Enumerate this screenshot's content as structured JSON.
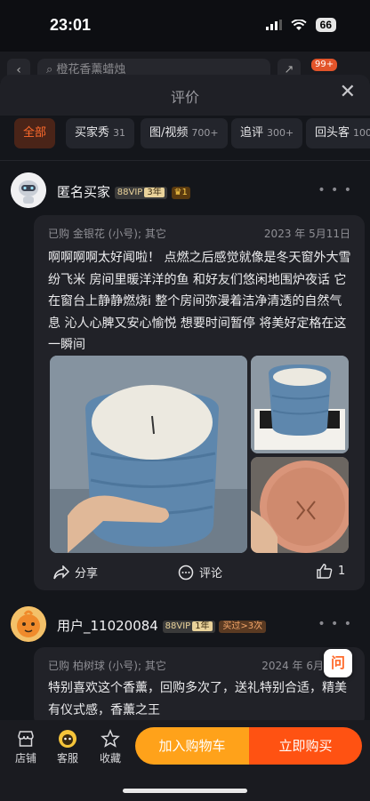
{
  "status": {
    "time": "23:01",
    "battery": "66"
  },
  "behind": {
    "search_text": "橙花香薰蜡烛",
    "cart_badge": "99+"
  },
  "sheet": {
    "title": "评价"
  },
  "filters": [
    {
      "label": "全部",
      "count": "",
      "active": true
    },
    {
      "label": "买家秀",
      "count": "31"
    },
    {
      "label": "图/视频",
      "count": "700+"
    },
    {
      "label": "追评",
      "count": "300+"
    },
    {
      "label": "回头客",
      "count": "100"
    }
  ],
  "review1": {
    "user": "匿名买家",
    "vip": "88VIP",
    "vip_years": "3年",
    "crown_level": "1",
    "purchase": "已购 金银花 (小号); 其它",
    "date": "2023 年 5月11日",
    "text": "啊啊啊啊太好闻啦！ 点燃之后感觉就像是冬天窗外大雪纷飞米 房间里暖洋洋的鱼 和好友们悠闲地围炉夜话 它在窗台上静静燃烧i 整个房间弥漫着洁净清透的自然气息 沁人心脾又安心愉悦 想要时间暂停 将美好定格在这一瞬间",
    "share": "分享",
    "comment": "评论",
    "likes": "1"
  },
  "review2": {
    "user": "用户_11020084",
    "vip": "88VIP",
    "vip_years": "1年",
    "repurchase_tag": "买过>3次",
    "purchase": "已购 柏树球 (小号); 其它",
    "date": "2024 年 6月",
    "text": "特别喜欢这个香薰，回购多次了，送礼特别合适，精美有仪式感，香薰之王",
    "ask_label": "问"
  },
  "bottom": {
    "store": "店铺",
    "service": "客服",
    "favorite": "收藏",
    "add_cart": "加入购物车",
    "buy_now": "立即购买"
  },
  "colors": {
    "accent": "#ff5212",
    "cart": "#ffa21a",
    "active_chip": "#ff6b2c"
  }
}
